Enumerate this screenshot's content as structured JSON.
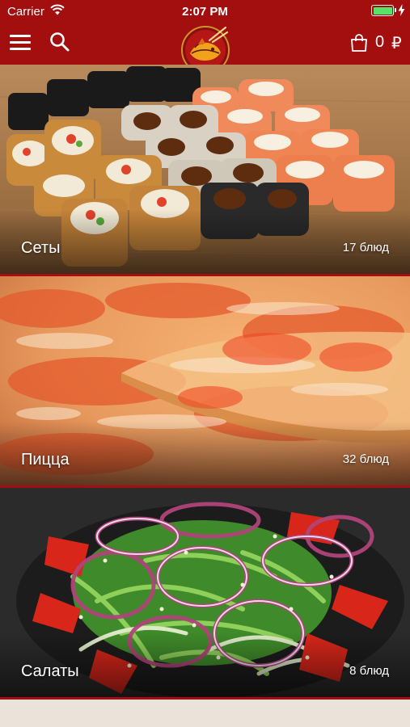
{
  "status_bar": {
    "carrier": "Carrier",
    "time": "2:07 PM",
    "battery_level": 1.0
  },
  "header": {
    "menu_icon": "hamburger-menu-icon",
    "search_icon": "search-icon",
    "logo_icon": "fish-chopsticks-logo",
    "cart_icon": "shopping-bag-icon",
    "cart_count": "0",
    "currency": "₽",
    "background_color": "#a30e0e"
  },
  "categories": [
    {
      "title": "Сеты",
      "count": "17 блюд"
    },
    {
      "title": "Пицца",
      "count": "32 блюд"
    },
    {
      "title": "Салаты",
      "count": "8 блюд"
    }
  ]
}
